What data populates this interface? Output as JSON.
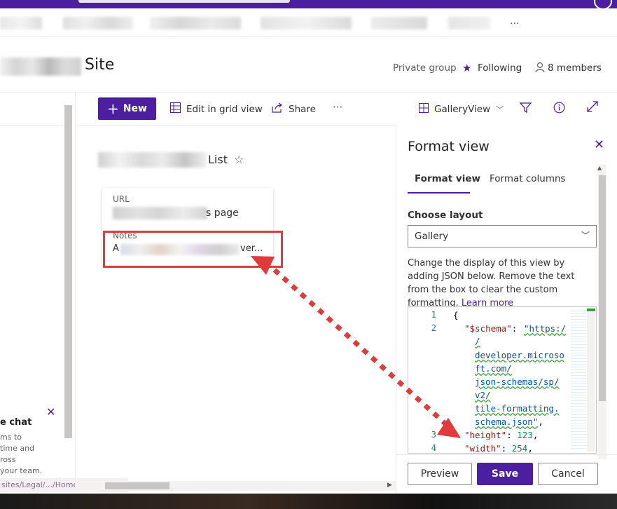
{
  "nav": {
    "more_label": "..."
  },
  "header": {
    "site_title": "Site",
    "group_type": "Private group",
    "following_label": "Following",
    "members_label": "8 members"
  },
  "command_bar": {
    "new_label": "New",
    "edit_grid_label": "Edit in grid view",
    "share_label": "Share",
    "more_label": "···",
    "view_label": "GalleryView"
  },
  "list": {
    "title_suffix": "List",
    "card": {
      "url_label": "URL",
      "url_value_suffix": "s page",
      "notes_label": "Notes",
      "notes_value_start": "A",
      "notes_value_suffix": "ver..."
    }
  },
  "left_panel": {
    "chat_title": "e chat",
    "chat_lines": [
      "ms to",
      "time and",
      "ross",
      "your team."
    ],
    "status_url": "sites/Legal/.../Home.aspx"
  },
  "format_panel": {
    "title": "Format view",
    "tabs": [
      {
        "label": "Format view",
        "active": true
      },
      {
        "label": "Format columns",
        "active": false
      }
    ],
    "choose_layout_label": "Choose layout",
    "layout_value": "Gallery",
    "description": "Change the display of this view by adding JSON below. Remove the text from the box to clear the custom formatting.",
    "learn_more": "Learn more",
    "code": {
      "line_numbers": [
        "1",
        "2",
        "3",
        "4"
      ],
      "open_brace": "{",
      "schema_key": "\"$schema\"",
      "schema_lines": [
        "\"https:/",
        "/",
        "developer.microso",
        "ft.com/",
        "json-schemas/sp/",
        "v2/",
        "tile-formatting.",
        "schema.json\""
      ],
      "height_key": "\"height\"",
      "height_value": "123",
      "width_key": "\"width\"",
      "width_value": "254"
    },
    "buttons": {
      "preview": "Preview",
      "save": "Save",
      "cancel": "Cancel"
    }
  },
  "colors": {
    "brand": "#4b1fa0",
    "annotation_red": "#e03a3a"
  }
}
